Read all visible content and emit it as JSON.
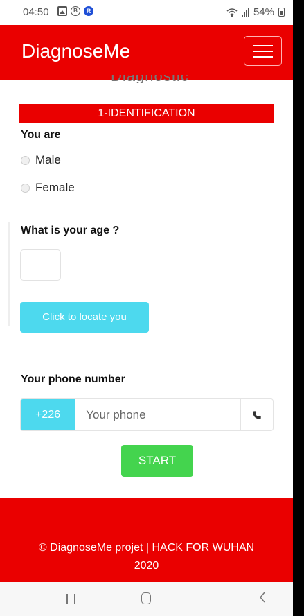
{
  "status_bar": {
    "time": "04:50",
    "battery_text": "54%"
  },
  "header": {
    "brand": "DiagnoseMe",
    "partial_title": "Diagnostic"
  },
  "section": {
    "title": "1-IDENTIFICATION"
  },
  "gender": {
    "label": "You are",
    "options": [
      "Male",
      "Female"
    ]
  },
  "age": {
    "label": "What is your age ?",
    "value": ""
  },
  "locate": {
    "label": "Click to locate you"
  },
  "phone": {
    "label": "Your phone number",
    "prefix": "+226",
    "placeholder": "Your phone"
  },
  "start": {
    "label": "START"
  },
  "footer": {
    "line1": "© DiagnoseMe projet | HACK FOR WUHAN",
    "line2": "2020"
  },
  "colors": {
    "brand_red": "#ea0000",
    "info_cyan": "#4dd9ee",
    "success_green": "#44d44e"
  }
}
